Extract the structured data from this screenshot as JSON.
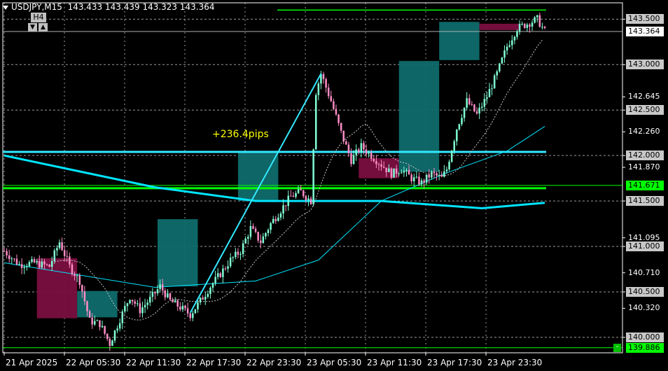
{
  "header": {
    "symbol": "USDJPY,M15",
    "ohlc": "143.433 143.439 143.323 143.364"
  },
  "timeframe": {
    "label": "H4",
    "down_icon": "▼",
    "up_icon": "▲"
  },
  "annotation": "+236.4pips",
  "price_axis": {
    "labels": [
      "143.500",
      "143.000",
      "142.645",
      "142.500",
      "142.260",
      "142.000",
      "141.870",
      "141.500",
      "141.095",
      "141.000",
      "140.710",
      "140.500",
      "140.320",
      "140.000"
    ],
    "current_price": "143.364",
    "hline_price": "141.671",
    "low_price": "139.886"
  },
  "time_axis": {
    "labels": [
      "21 Apr 2025",
      "22 Apr 05:30",
      "22 Apr 11:30",
      "22 Apr 17:30",
      "22 Apr 23:30",
      "23 Apr 05:30",
      "23 Apr 11:30",
      "23 Apr 17:30",
      "23 Apr 23:30"
    ]
  },
  "colors": {
    "background": "#000000",
    "bull_candle": "#7fffd4",
    "bear_candle": "#ff8dc7",
    "h4_bull": "#0f6b6b",
    "h4_bear": "#7a0f3f",
    "ma_color": "#00e5ff",
    "hline_cyan": "#33e8ff",
    "hline_green": "#00ff00"
  },
  "chart_data": {
    "type": "candlestick",
    "symbol": "USDJPY",
    "timeframe": "M15",
    "y_range": [
      139.83,
      143.68
    ],
    "x_range": [
      "21 Apr 2025",
      "23 Apr 23:30"
    ],
    "horizontal_lines": [
      {
        "price": 142.04,
        "color": "cyan"
      },
      {
        "price": 141.671,
        "color": "green"
      },
      {
        "price": 141.64,
        "color": "green"
      },
      {
        "price": 139.886,
        "color": "green"
      },
      {
        "price": 143.6,
        "color": "green"
      }
    ],
    "h4_boxes": [
      {
        "start": "22 Apr 00:45",
        "end": "22 Apr 04:45",
        "open": 140.87,
        "close": 140.21
      },
      {
        "start": "22 Apr 04:45",
        "end": "22 Apr 08:45",
        "open": 140.22,
        "close": 140.51
      },
      {
        "start": "22 Apr 12:45",
        "end": "22 Apr 16:45",
        "open": 140.56,
        "close": 141.3
      },
      {
        "start": "22 Apr 20:45",
        "end": "23 Apr 00:45",
        "open": 141.5,
        "close": 142.05
      },
      {
        "start": "23 Apr 08:45",
        "end": "23 Apr 12:45",
        "open": 141.97,
        "close": 141.75
      },
      {
        "start": "23 Apr 12:45",
        "end": "23 Apr 16:45",
        "open": 141.82,
        "close": 143.04
      },
      {
        "start": "23 Apr 16:45",
        "end": "23 Apr 20:45",
        "open": 143.05,
        "close": 143.47
      },
      {
        "start": "23 Apr 20:45",
        "end": "24 Apr 00:45",
        "open": 143.45,
        "close": 143.38
      }
    ],
    "close_path": [
      [
        0,
        140.95
      ],
      [
        6,
        140.8
      ],
      [
        12,
        140.82
      ],
      [
        18,
        140.78
      ],
      [
        22,
        141.05
      ],
      [
        26,
        140.78
      ],
      [
        30,
        140.62
      ],
      [
        34,
        140.18
      ],
      [
        38,
        140.15
      ],
      [
        42,
        139.93
      ],
      [
        46,
        140.2
      ],
      [
        50,
        140.45
      ],
      [
        54,
        140.3
      ],
      [
        58,
        140.42
      ],
      [
        62,
        140.56
      ],
      [
        66,
        140.4
      ],
      [
        70,
        140.33
      ],
      [
        74,
        140.25
      ],
      [
        78,
        140.4
      ],
      [
        82,
        140.56
      ],
      [
        86,
        140.7
      ],
      [
        90,
        140.85
      ],
      [
        94,
        140.95
      ],
      [
        98,
        141.2
      ],
      [
        102,
        141.05
      ],
      [
        106,
        141.25
      ],
      [
        110,
        141.4
      ],
      [
        114,
        141.55
      ],
      [
        118,
        141.6
      ],
      [
        122,
        141.5
      ],
      [
        124,
        142.7
      ],
      [
        126,
        142.9
      ],
      [
        130,
        142.6
      ],
      [
        134,
        142.25
      ],
      [
        138,
        141.95
      ],
      [
        142,
        142.1
      ],
      [
        146,
        142.0
      ],
      [
        150,
        141.9
      ],
      [
        154,
        141.8
      ],
      [
        158,
        141.85
      ],
      [
        162,
        141.75
      ],
      [
        166,
        141.7
      ],
      [
        170,
        141.8
      ],
      [
        174,
        141.75
      ],
      [
        176,
        141.85
      ],
      [
        180,
        142.3
      ],
      [
        184,
        142.6
      ],
      [
        188,
        142.45
      ],
      [
        192,
        142.65
      ],
      [
        196,
        142.9
      ],
      [
        200,
        143.2
      ],
      [
        204,
        143.4
      ],
      [
        208,
        143.45
      ],
      [
        212,
        143.5
      ],
      [
        215,
        143.364
      ]
    ],
    "moving_averages": [
      {
        "name": "",
        "points": [
          [
            0,
            142.0
          ],
          [
            60,
            141.65
          ],
          [
            100,
            141.5
          ],
          [
            150,
            141.5
          ],
          [
            190,
            141.42
          ],
          [
            215,
            141.48
          ]
        ]
      },
      {
        "name": "",
        "points": [
          [
            0,
            140.82
          ],
          [
            60,
            140.55
          ],
          [
            100,
            140.62
          ],
          [
            125,
            140.85
          ],
          [
            150,
            141.5
          ],
          [
            175,
            141.8
          ],
          [
            200,
            142.05
          ],
          [
            215,
            142.32
          ]
        ]
      }
    ]
  }
}
